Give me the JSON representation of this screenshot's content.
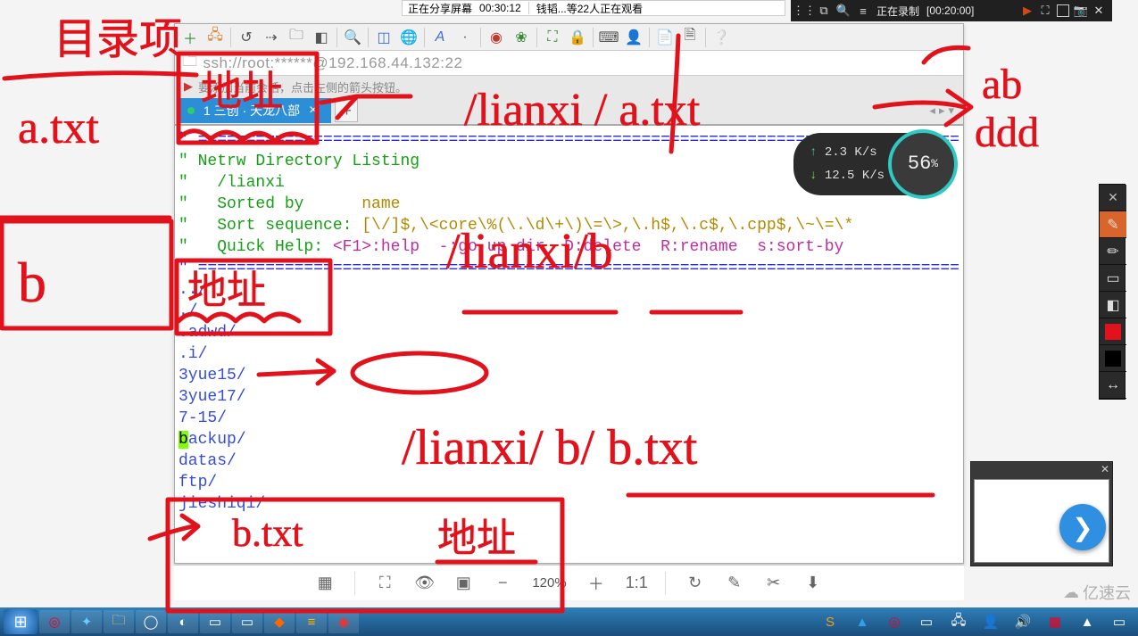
{
  "share_bar": {
    "label": "正在分享屏幕",
    "time": "00:30:12",
    "viewers": "钱韬...等22人正在观看"
  },
  "rec_bar": {
    "label": "正在录制",
    "time": "[00:20:00]"
  },
  "toolbar_icons": [
    "plus",
    "chain",
    "refresh",
    "flow",
    "folder",
    "dotbox",
    "search",
    "grid",
    "globe",
    "font",
    "bold",
    "spiral",
    "leaf",
    "expand",
    "lock",
    "keyboard",
    "person",
    "newdoc",
    "copydoc",
    "help"
  ],
  "path_bar": {
    "text": "ssh://root:******@192.168.44.132:22"
  },
  "info_row": {
    "text": "要添加当前会话，点击左侧的箭头按钮。"
  },
  "tab": {
    "label": "1 三创 · 天龙八部"
  },
  "net_widget": {
    "up": "2.3 K/s",
    "down": "12.5 K/s",
    "percent": "56"
  },
  "terminal": {
    "rule": "\" ===============================================================================",
    "header": "\" Netrw Directory Listing",
    "cwd_line": "\"   /lianxi",
    "sorted_label": "\"   Sorted by      ",
    "sorted_value": "name",
    "seq_label": "\"   Sort sequence: ",
    "seq_value": "[\\/]$,\\<core\\%(\\.\\d\\+\\)\\=\\>,\\.h$,\\.c$,\\.cpp$,\\~\\=\\*",
    "help_label": "\"   Quick Help: ",
    "help_value": "<F1>:help  -:go up dir  D:delete  R:rename  s:sort-by",
    "entries": [
      "../",
      "./",
      ".adwd/",
      ".i/",
      "3yue15/",
      "3yue17/",
      "7-15/",
      "backup/",
      "datas/",
      "ftp/",
      "jieshiqi/"
    ]
  },
  "imgbar": {
    "zoom": "120%"
  },
  "annotations": {
    "top_left_1": "目录项",
    "top_left_2": "a.txt",
    "left_box": "b",
    "addr1": "地址",
    "addr2": "地址",
    "addr3": "地址",
    "path1": "/lianxi / a.txt",
    "path2": "/lianxi/b",
    "path3": "/lianxi/ b/ b.txt",
    "right1": "ab",
    "right2": "ddd",
    "btxt": "b.txt"
  },
  "brand": "亿速云"
}
